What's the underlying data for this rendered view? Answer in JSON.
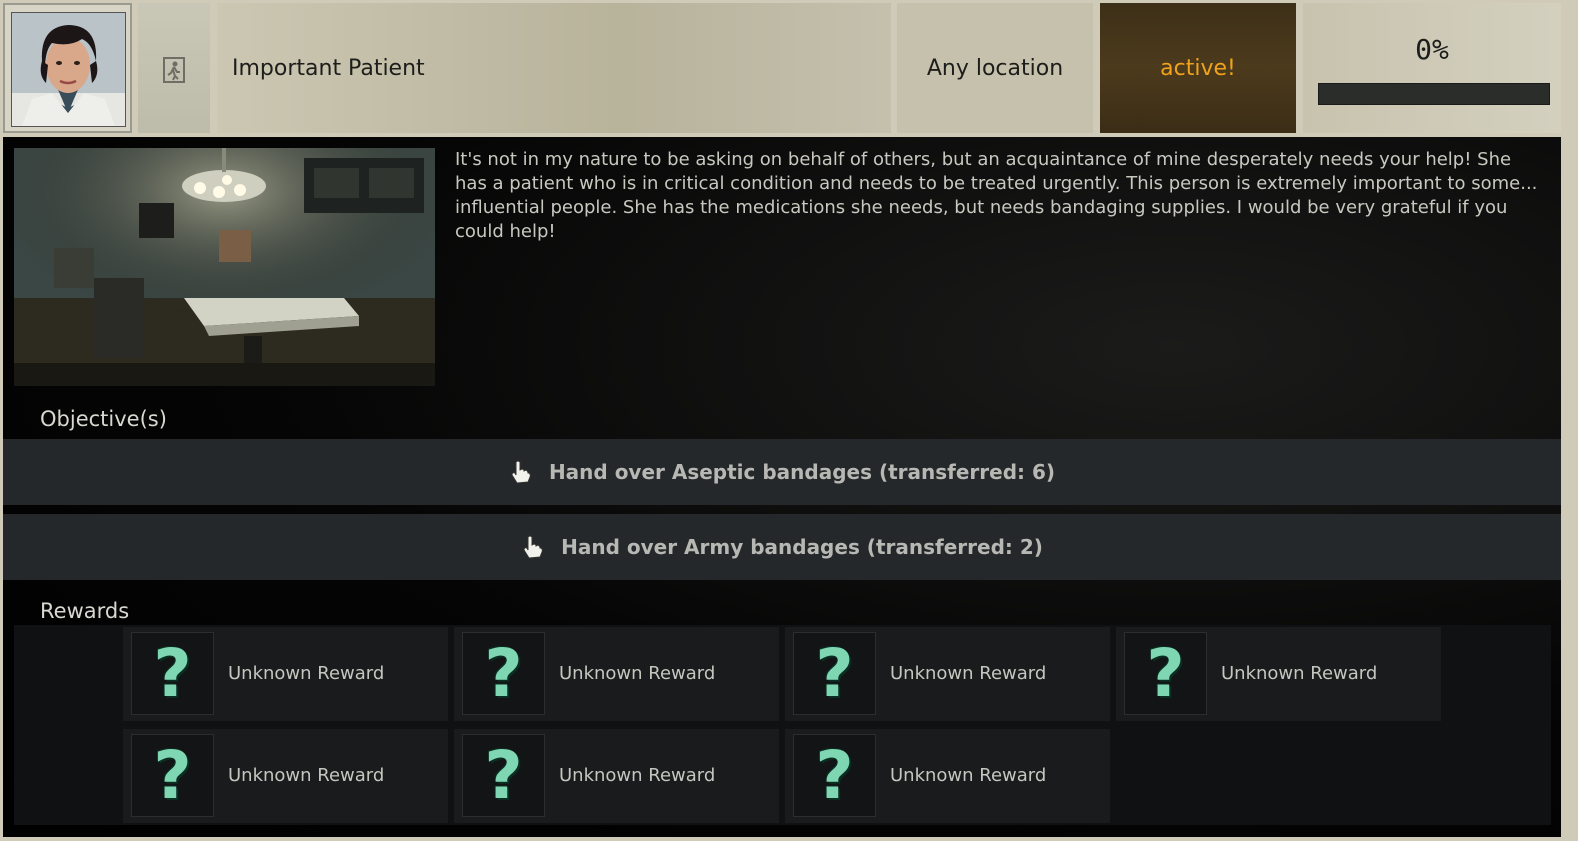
{
  "header": {
    "quest_title": "Important Patient",
    "location": "Any location",
    "status": "active!",
    "progress_text": "0%",
    "progress_value": 0,
    "status_color": "#f0a21d"
  },
  "description": "It's not in my nature to be asking on behalf of others, but an acquaintance of mine desperately needs your help! She has a patient who is in critical condition and needs to be treated urgently. This person is extremely important to some... influential people. She has the medications she needs, but needs bandaging supplies. I would be very grateful if you could help!",
  "objectives": {
    "label": "Objective(s)",
    "items": [
      {
        "text": "Hand over Aseptic bandages (transferred: 6)",
        "icon": "hand-pointer-icon"
      },
      {
        "text": "Hand over Army bandages (transferred: 2)",
        "icon": "hand-pointer-icon"
      }
    ]
  },
  "rewards": {
    "label": "Rewards",
    "items": [
      {
        "label": "Unknown Reward",
        "icon": "question-mark-icon"
      },
      {
        "label": "Unknown Reward",
        "icon": "question-mark-icon"
      },
      {
        "label": "Unknown Reward",
        "icon": "question-mark-icon"
      },
      {
        "label": "Unknown Reward",
        "icon": "question-mark-icon"
      },
      {
        "label": "Unknown Reward",
        "icon": "question-mark-icon"
      },
      {
        "label": "Unknown Reward",
        "icon": "question-mark-icon"
      },
      {
        "label": "Unknown Reward",
        "icon": "question-mark-icon"
      }
    ],
    "icon_glyph": "?"
  }
}
